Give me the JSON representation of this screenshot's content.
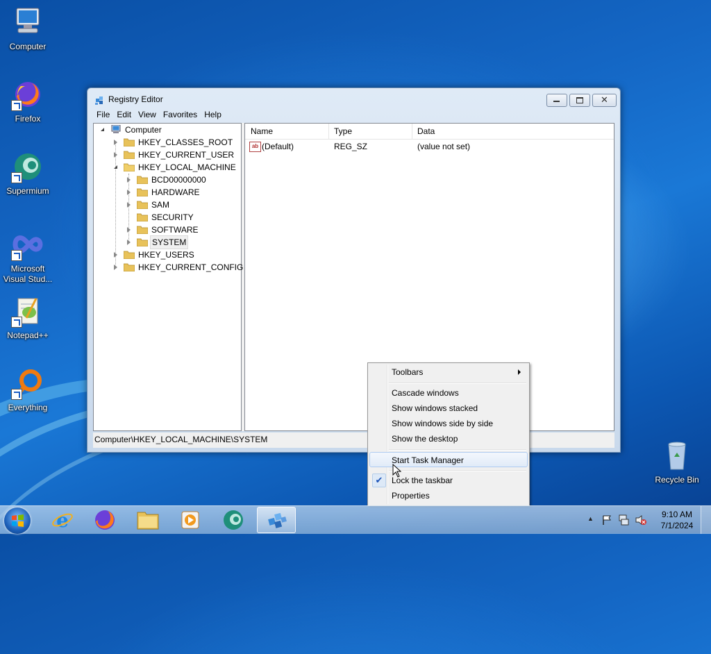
{
  "desktop": {
    "icons": [
      {
        "label": "Computer"
      },
      {
        "label": "Firefox"
      },
      {
        "label": "Supermium"
      },
      {
        "label": "Microsoft Visual Stud..."
      },
      {
        "label": "Notepad++"
      },
      {
        "label": "Everything"
      },
      {
        "label": "Recycle Bin"
      }
    ]
  },
  "window": {
    "title": "Registry Editor",
    "menu": [
      "File",
      "Edit",
      "View",
      "Favorites",
      "Help"
    ],
    "tree": {
      "root": "Computer",
      "hives": [
        "HKEY_CLASSES_ROOT",
        "HKEY_CURRENT_USER",
        "HKEY_LOCAL_MACHINE",
        "HKEY_USERS",
        "HKEY_CURRENT_CONFIG"
      ],
      "hklm_children": [
        "BCD00000000",
        "HARDWARE",
        "SAM",
        "SECURITY",
        "SOFTWARE",
        "SYSTEM"
      ],
      "selected": "SYSTEM"
    },
    "list": {
      "columns": [
        "Name",
        "Type",
        "Data"
      ],
      "rows": [
        {
          "name": "(Default)",
          "type": "REG_SZ",
          "data": "(value not set)",
          "icon": "ab"
        }
      ]
    },
    "status": "Computer\\HKEY_LOCAL_MACHINE\\SYSTEM"
  },
  "context_menu": {
    "items": {
      "toolbars": "Toolbars",
      "cascade": "Cascade windows",
      "stacked": "Show windows stacked",
      "side_by_side": "Show windows side by side",
      "show_desktop": "Show the desktop",
      "task_manager": "Start Task Manager",
      "lock_taskbar": "Lock the taskbar",
      "properties": "Properties"
    },
    "lock_checked": true
  },
  "taskbar": {
    "clock_time": "9:10 AM",
    "clock_date": "7/1/2024"
  },
  "colors": {
    "accent": "#1a78d6",
    "checkmark": "#1a52b7"
  }
}
